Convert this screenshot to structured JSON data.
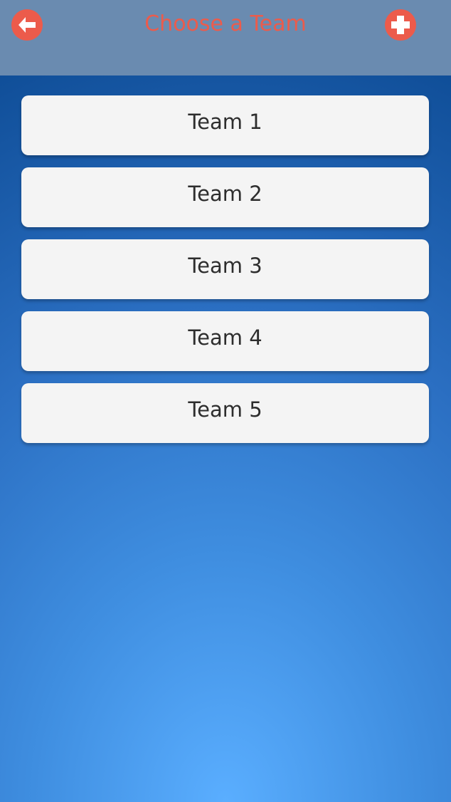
{
  "header": {
    "title": "Choose a Team",
    "accent_color": "#ec5b4b",
    "background_color": "#6a8bb0",
    "back_icon": "arrow-left-icon",
    "add_icon": "plus-icon"
  },
  "teams": [
    {
      "label": "Team 1"
    },
    {
      "label": "Team 2"
    },
    {
      "label": "Team 3"
    },
    {
      "label": "Team 4"
    },
    {
      "label": "Team 5"
    }
  ]
}
